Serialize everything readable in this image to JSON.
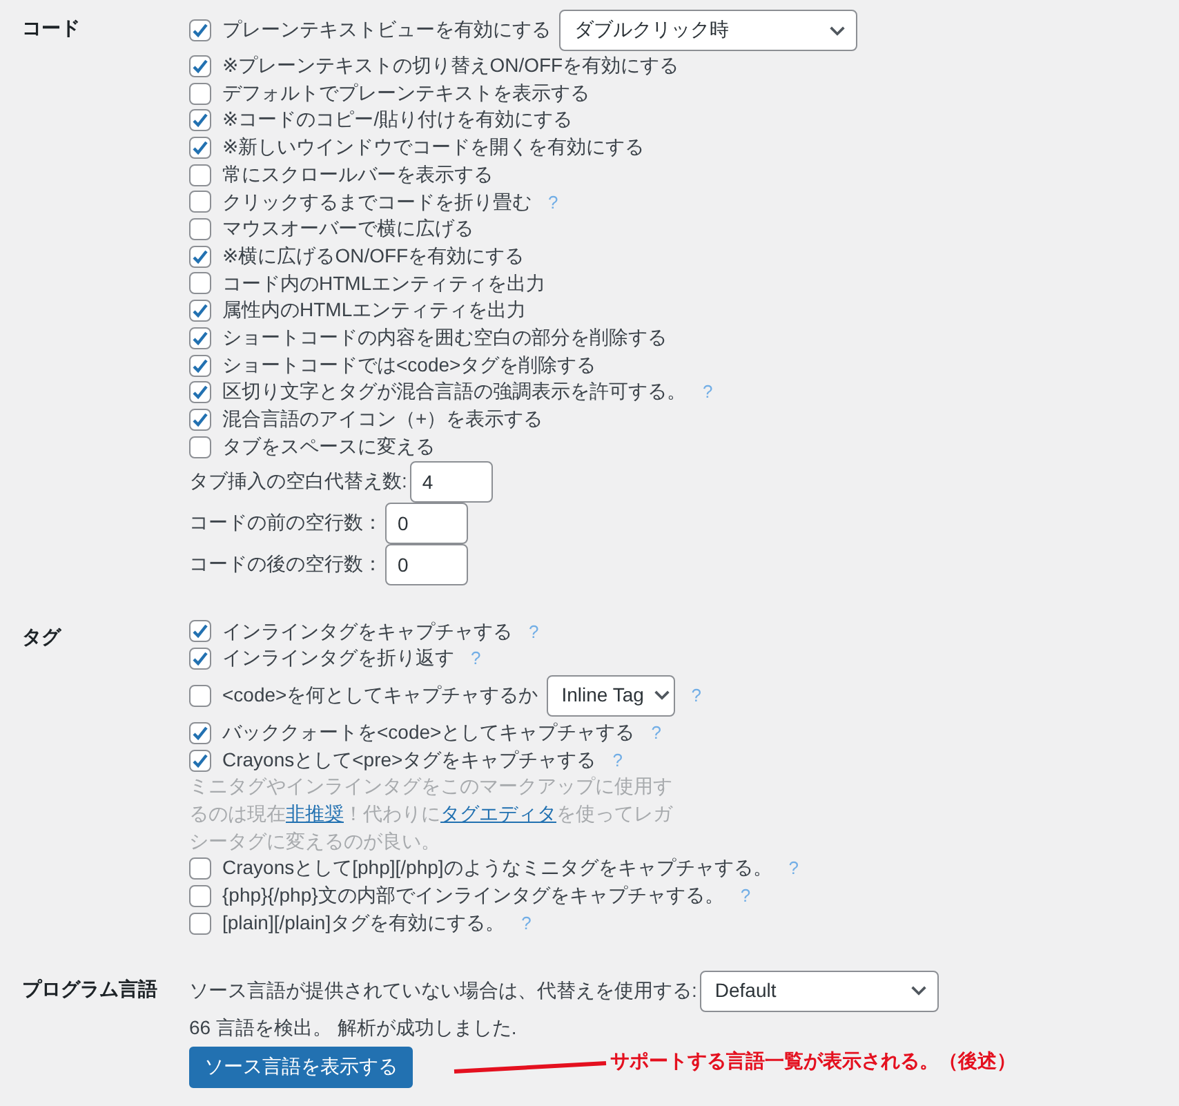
{
  "sections": [
    {
      "heading": "コード",
      "items": [
        {
          "kind": "checkbox",
          "label": "プレーンテキストビューを有効にする",
          "checked": true,
          "select": "ダブルクリック時"
        },
        {
          "kind": "checkbox",
          "label": "※プレーンテキストの切り替えON/OFFを有効にする",
          "checked": true
        },
        {
          "kind": "checkbox",
          "label": "デフォルトでプレーンテキストを表示する",
          "checked": false
        },
        {
          "kind": "checkbox",
          "label": "※コードのコピー/貼り付けを有効にする",
          "checked": true
        },
        {
          "kind": "checkbox",
          "label": "※新しいウインドウでコードを開くを有効にする",
          "checked": true
        },
        {
          "kind": "checkbox",
          "label": "常にスクロールバーを表示する",
          "checked": false
        },
        {
          "kind": "checkbox",
          "label": "クリックするまでコードを折り畳む",
          "checked": false,
          "help": "?"
        },
        {
          "kind": "checkbox",
          "label": "マウスオーバーで横に広げる",
          "checked": false
        },
        {
          "kind": "checkbox",
          "label": "※横に広げるON/OFFを有効にする",
          "checked": true
        },
        {
          "kind": "checkbox",
          "label": "コード内のHTMLエンティティを出力",
          "checked": false
        },
        {
          "kind": "checkbox",
          "label": "属性内のHTMLエンティティを出力",
          "checked": true
        },
        {
          "kind": "checkbox",
          "label": "ショートコードの内容を囲む空白の部分を削除する",
          "checked": true
        },
        {
          "kind": "checkbox",
          "label": "ショートコードでは<code>タグを削除する",
          "checked": true
        },
        {
          "kind": "checkbox",
          "label": "区切り文字とタグが混合言語の強調表示を許可する。",
          "checked": true,
          "help": "?"
        },
        {
          "kind": "checkbox",
          "label": "混合言語のアイコン（+）を表示する",
          "checked": true
        },
        {
          "kind": "checkbox",
          "label": "タブをスペースに変える",
          "checked": false
        },
        {
          "kind": "number",
          "label": "タブ挿入の空白代替え数:",
          "value": "4"
        },
        {
          "kind": "number",
          "label": "コードの前の空行数：",
          "value": "0"
        },
        {
          "kind": "number",
          "label": "コードの後の空行数：",
          "value": "0"
        }
      ]
    },
    {
      "heading": "タグ",
      "items": [
        {
          "kind": "checkbox",
          "label": "インラインタグをキャプチャする",
          "checked": true,
          "help": "?"
        },
        {
          "kind": "checkbox",
          "label": "インラインタグを折り返す",
          "checked": true,
          "help": "?"
        },
        {
          "kind": "checkbox",
          "label": "<code>を何としてキャプチャするか",
          "checked": false,
          "select": "Inline Tag",
          "help": "?"
        },
        {
          "kind": "checkbox",
          "label": "バッククォートを<code>としてキャプチャする",
          "checked": true,
          "help": "?"
        },
        {
          "kind": "checkbox",
          "label": "Crayonsとして<pre>タグをキャプチャする",
          "checked": true,
          "help": "?"
        },
        {
          "kind": "note",
          "parts": [
            {
              "kind": "text",
              "text": "ミニタグやインラインタグをこのマークアップに使用するのは現在"
            },
            {
              "kind": "link",
              "text": "非推奨"
            },
            {
              "kind": "text",
              "text": "！代わりに"
            },
            {
              "kind": "link",
              "text": "タグエディタ"
            },
            {
              "kind": "text",
              "text": "を使ってレガシータグに変えるのが良い。"
            }
          ]
        },
        {
          "kind": "checkbox",
          "label": "Crayonsとして[php][/php]のようなミニタグをキャプチャする。",
          "checked": false,
          "help": "?"
        },
        {
          "kind": "checkbox",
          "label": "{php}{/php}文の内部でインラインタグをキャプチャする。",
          "checked": false,
          "help": "?"
        },
        {
          "kind": "checkbox",
          "label": "[plain][/plain]タグを有効にする。",
          "checked": false,
          "help": "?"
        }
      ]
    },
    {
      "heading": "プログラム言語",
      "items": [
        {
          "kind": "select",
          "label": "ソース言語が提供されていない場合は、代替えを使用する:",
          "select": "Default"
        },
        {
          "kind": "text",
          "text": "66 言語を検出。 解析が成功しました."
        },
        {
          "kind": "button",
          "label": "ソース言語を表示する",
          "annotation": "サポートする言語一覧が表示される。（後述）"
        }
      ]
    }
  ]
}
